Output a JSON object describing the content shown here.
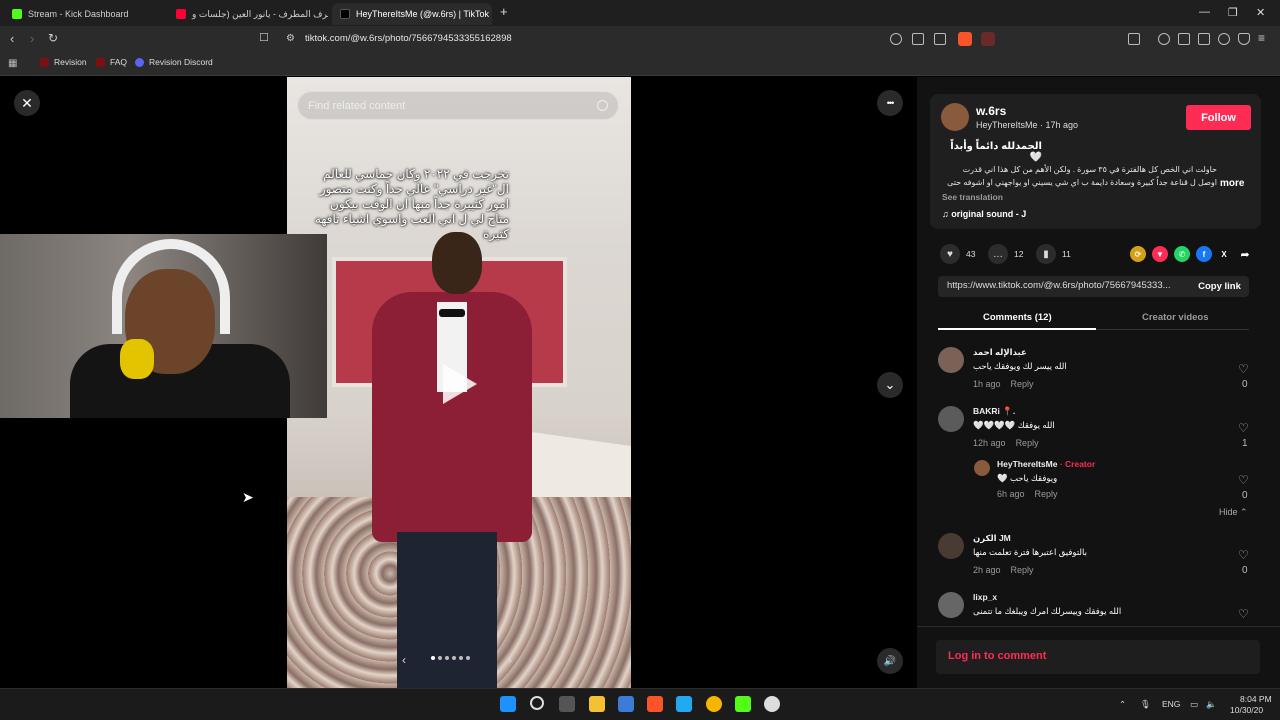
{
  "browser": {
    "tabs": [
      {
        "label": "Stream - Kick Dashboard",
        "color": "#53fc18"
      },
      {
        "label": "مطرف المطرف - يانور العين (جلسات و",
        "color": "#ff0033"
      },
      {
        "label": "HeyThereItsMe (@w.6rs) | TikTok",
        "color": "#000000"
      }
    ],
    "url": "tiktok.com/@w.6rs/photo/7566794533355162898",
    "bookmarks": [
      "Revision",
      "FAQ",
      "Revision Discord"
    ],
    "new_tab": "+",
    "min": "—",
    "max": "❐",
    "close": "✕"
  },
  "viewer": {
    "search_placeholder": "Find related content",
    "overlay_text": "تخرجت في ٢٠٢٢ وكان حماسي للعالم ال\"غير دراسي\" عالي جداً وكنت متصور امور كثييرة جداً منها ان الوقت بيكون متاح لي ل اني العب واسوي اشياء تافهه كثيرة",
    "close_icon": "✕",
    "more_icon": "•••",
    "down_icon": "⌄",
    "volume_icon": "🔊",
    "prev": "‹",
    "next": "›",
    "carousel_total": 6,
    "carousel_current": 1
  },
  "post": {
    "username": "w.6rs",
    "display": "HeyThereItsMe · 17h ago",
    "follow": "Follow",
    "title": "الحمدلله دائماً وأبداً 🤍",
    "description": "حاولت اني الخص كل هالفترة في ٣٥ سورة . ولكن الأهم من كل هذا اني قدرت اوصل ل قناعة جداً كبيرة وسعادة دايمة ب اي شي يسيني او يواجهني او اشوفه حتى ب",
    "more": "more",
    "see_translation": "See translation",
    "sound": "♫  original sound - J",
    "likes": "43",
    "comments": "12",
    "saves": "11",
    "link": "https://www.tiktok.com/@w.6rs/photo/75667945333...",
    "copy_link": "Copy link",
    "tab_comments": "Comments (12)",
    "tab_creator": "Creator videos",
    "login": "Log in to comment"
  },
  "comments": [
    {
      "name": "عبدالإله احمد",
      "text": "الله ييسر لك ويوفقك ياحب",
      "time": "1h ago",
      "reply": "Reply",
      "likes": "0"
    },
    {
      "name": "BAKRi 📍.",
      "text": "🤍🤍🤍🤍 الله يوفقك",
      "time": "12h ago",
      "reply": "Reply",
      "likes": "1"
    },
    {
      "name": "HeyThereItsMe",
      "creator": "· Creator",
      "text": "🤍 ويوفقك ياحب",
      "time": "6h ago",
      "reply": "Reply",
      "likes": "0"
    },
    {
      "name": "الكرن JM",
      "text": "بالتوفيق اعتبرها فترة تعلمت منها",
      "time": "2h ago",
      "reply": "Reply",
      "likes": "0"
    },
    {
      "name": "lixp_x",
      "text": "الله يوفقك وييسرلك امرك ويبلغك ما تتمنى",
      "time": "",
      "reply": "",
      "likes": ""
    }
  ],
  "hide": "Hide ⌃",
  "taskbar": {
    "lang": "ENG",
    "time": "8:04 PM",
    "date": "10/30/20"
  }
}
